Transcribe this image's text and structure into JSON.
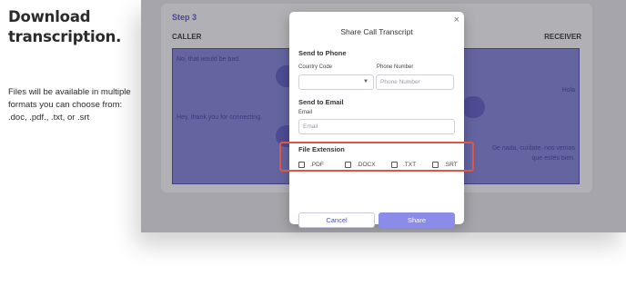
{
  "left_panel": {
    "title_line1": "Download",
    "title_line2": "transcription.",
    "description": "Files will be available in multiple formats you can choose from: .doc, .pdf., .txt, or .srt"
  },
  "app": {
    "step_label": "Step 3",
    "caller_label": "CALLER",
    "receiver_label": "RECEIVER",
    "transcript_lines": [
      "No, that would be bad.",
      "Hey, thank you for connecting.",
      "Hola",
      "De nada, cuídate, nos vemos",
      "que estés bien."
    ]
  },
  "modal": {
    "title": "Share Call Transcript",
    "close_icon": "close-icon",
    "send_to_phone": {
      "heading": "Send to Phone",
      "country_code_label": "Country Code",
      "country_code_value": "",
      "phone_label": "Phone Number",
      "phone_placeholder": "Phone Number"
    },
    "send_to_email": {
      "heading": "Send to Email",
      "email_label": "Email",
      "email_placeholder": "Email"
    },
    "file_extension": {
      "heading": "File Extension",
      "options": [
        {
          "label": ".PDF",
          "checked": false
        },
        {
          "label": ".DOCX",
          "checked": false
        },
        {
          "label": ".TXT",
          "checked": false
        },
        {
          "label": ".SRT",
          "checked": false
        }
      ]
    },
    "cancel_label": "Cancel",
    "share_label": "Share"
  },
  "colors": {
    "accent": "#8b8bea",
    "highlight": "#e05545",
    "transcript_bg": "#7f7fde"
  }
}
